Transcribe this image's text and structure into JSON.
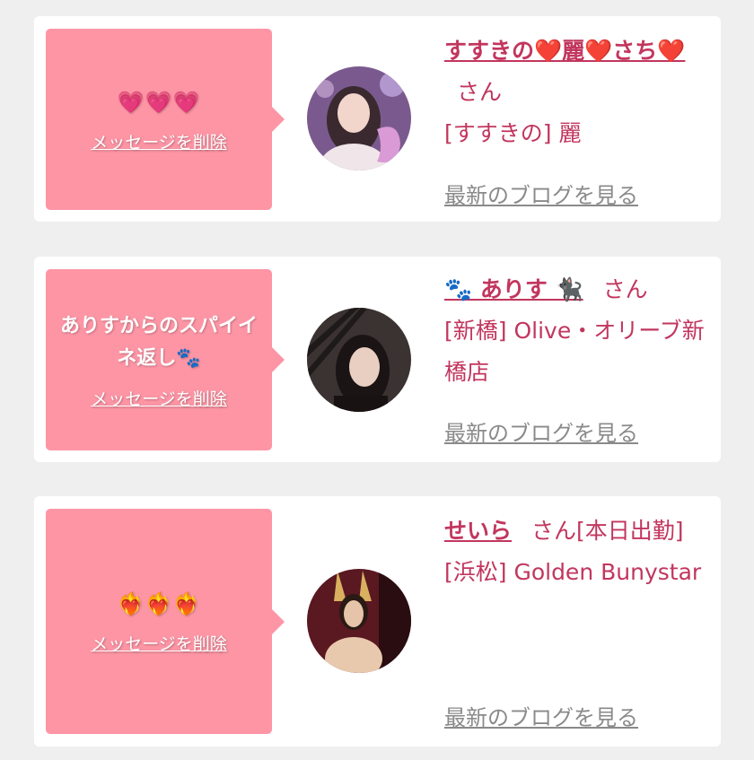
{
  "messages": [
    {
      "message": "💗💗💗",
      "delete_label": "メッセージを削除",
      "name": "すすきの❤️麗❤️さち❤️",
      "honorific": "さん",
      "shop": "[すすきの] 麗",
      "blog_link": "最新のブログを見る"
    },
    {
      "message": "ありすからのスパイイネ返し🐾",
      "delete_label": "メッセージを削除",
      "name": "🐾 ありす 🐈‍⬛",
      "honorific": "さん",
      "shop": "[新橋] Olive・オリーブ新橋店",
      "blog_link": "最新のブログを見る"
    },
    {
      "message": "❤️‍🔥❤️‍🔥❤️‍🔥",
      "delete_label": "メッセージを削除",
      "name": "せいら",
      "honorific": "さん[本日出勤]",
      "shop": "[浜松] Golden Bunystar",
      "blog_link": "最新のブログを見る"
    }
  ]
}
